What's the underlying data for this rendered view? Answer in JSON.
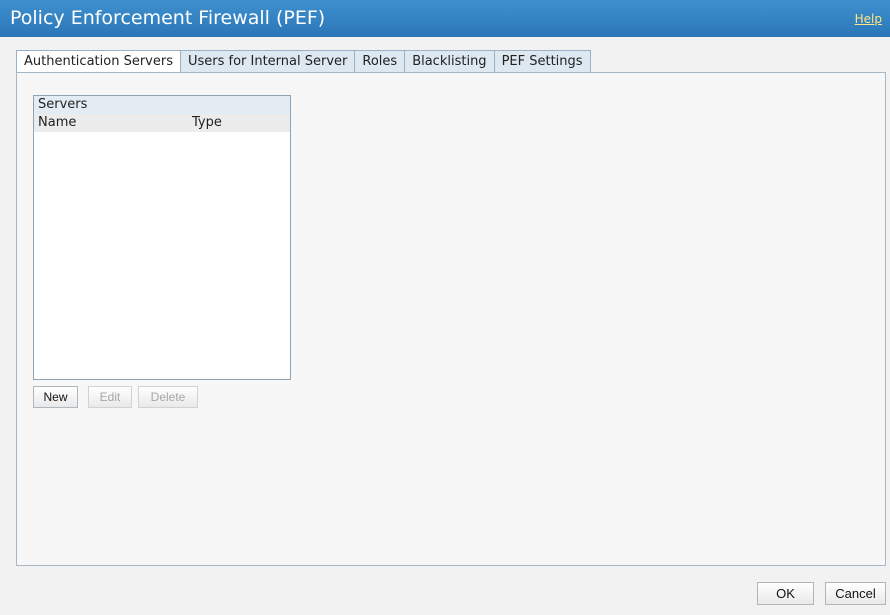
{
  "window": {
    "title": "Policy Enforcement Firewall (PEF)",
    "help_label": "Help"
  },
  "tabs": [
    {
      "label": "Authentication Servers",
      "active": true
    },
    {
      "label": "Users for Internal Server",
      "active": false
    },
    {
      "label": "Roles",
      "active": false
    },
    {
      "label": "Blacklisting",
      "active": false
    },
    {
      "label": "PEF Settings",
      "active": false
    }
  ],
  "servers": {
    "heading": "Servers",
    "columns": [
      "Name",
      "Type"
    ],
    "rows": []
  },
  "actions": {
    "new_label": "New",
    "edit_label": "Edit",
    "delete_label": "Delete"
  },
  "footer": {
    "ok_label": "OK",
    "cancel_label": "Cancel"
  },
  "colors": {
    "titlebar": "#2f7fc1",
    "help_link": "#ffe680",
    "tab_bg": "#dde8f1"
  }
}
